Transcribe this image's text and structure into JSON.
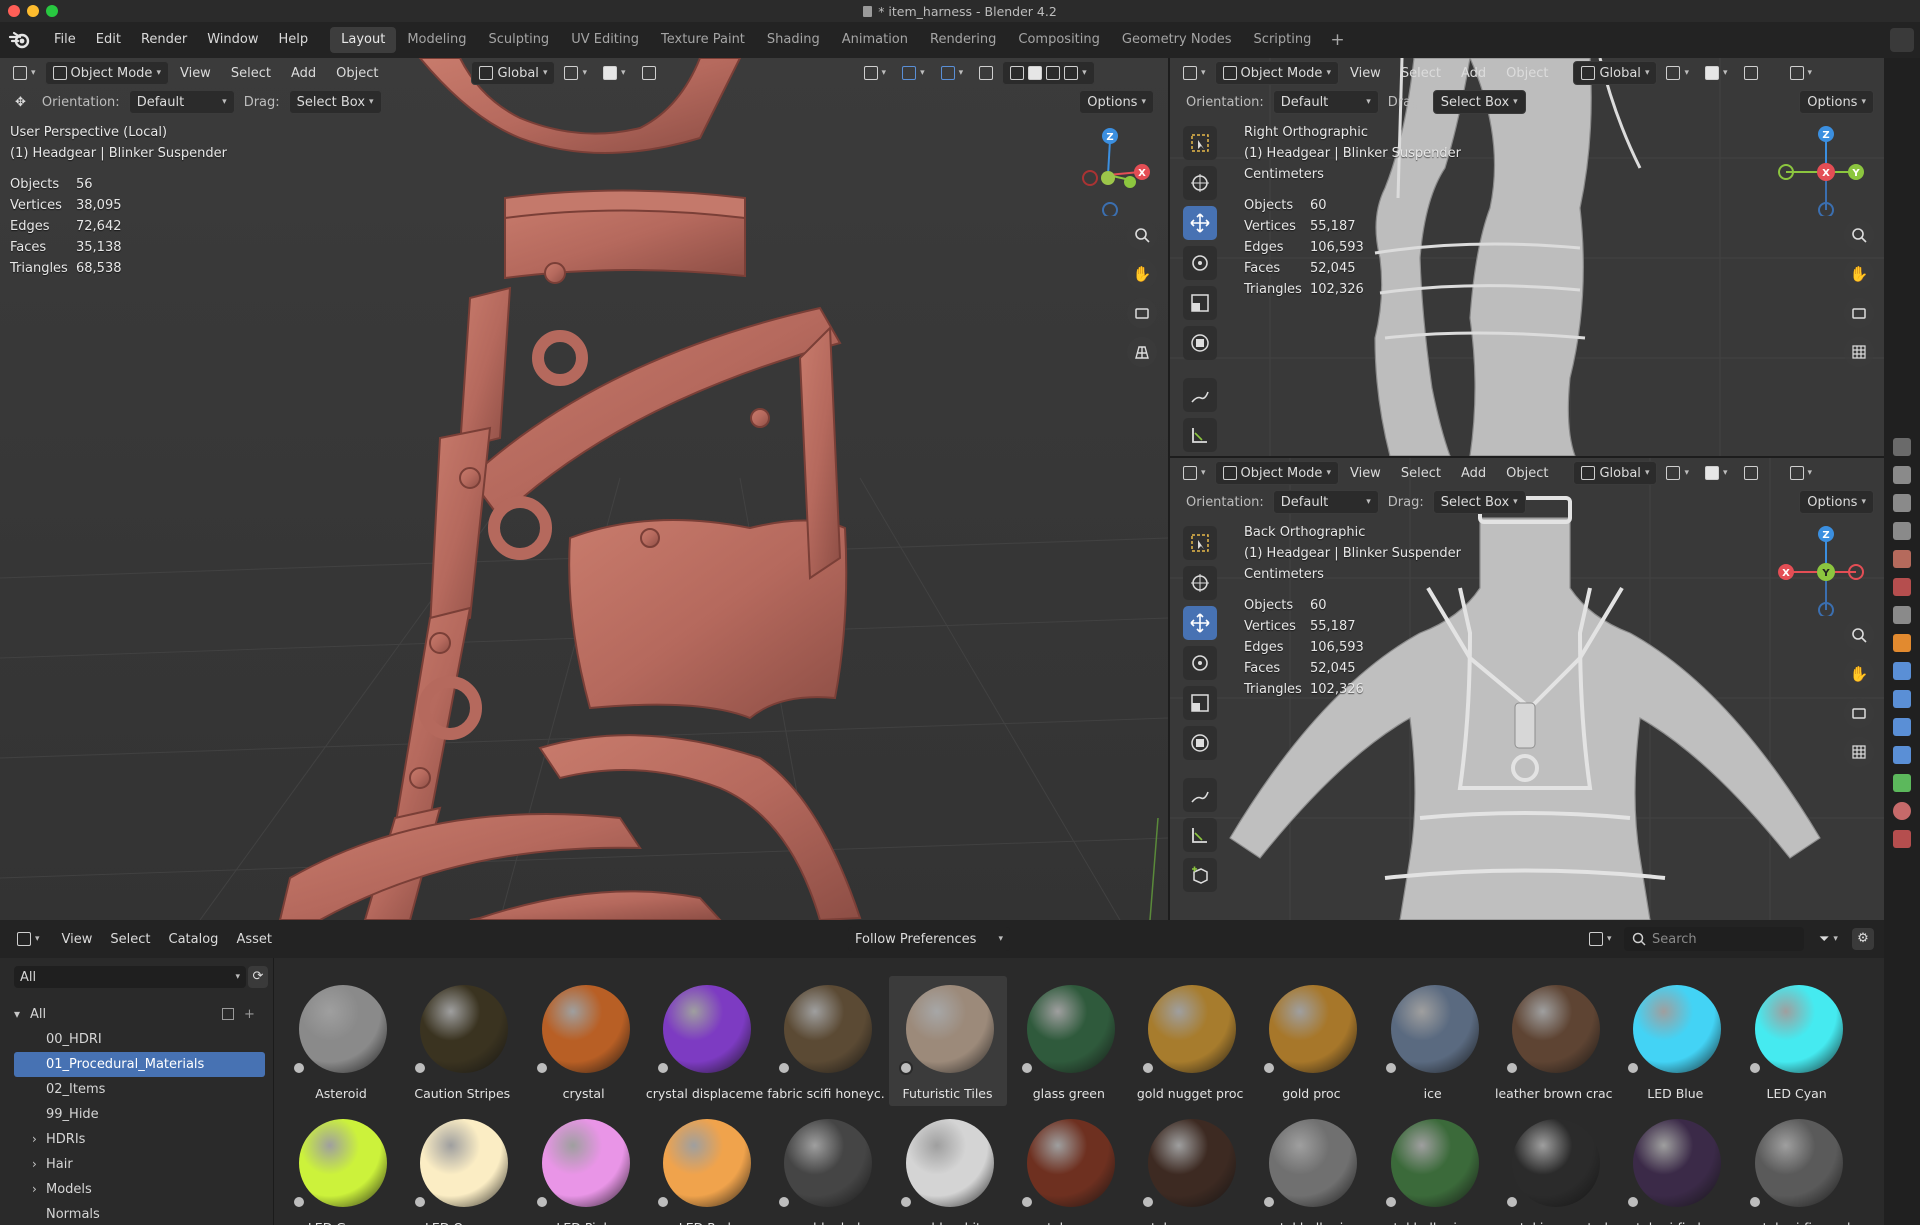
{
  "window": {
    "title": "* item_harness - Blender 4.2"
  },
  "menu": [
    "File",
    "Edit",
    "Render",
    "Window",
    "Help"
  ],
  "workspaces": [
    "Layout",
    "Modeling",
    "Sculpting",
    "UV Editing",
    "Texture Paint",
    "Shading",
    "Animation",
    "Rendering",
    "Compositing",
    "Geometry Nodes",
    "Scripting"
  ],
  "viewport_main": {
    "mode": "Object Mode",
    "menus": [
      "View",
      "Select",
      "Add",
      "Object"
    ],
    "transform_space": "Global",
    "orientation_label": "Orientation:",
    "orientation_value": "Default",
    "drag_label": "Drag:",
    "drag_value": "Select Box",
    "options": "Options",
    "view_name": "User Perspective (Local)",
    "object_name": "(1) Headgear | Blinker Suspender",
    "stats": {
      "labels": [
        "Objects",
        "Vertices",
        "Edges",
        "Faces",
        "Triangles"
      ],
      "values": [
        "56",
        "38,095",
        "72,642",
        "35,138",
        "68,538"
      ]
    },
    "gizmo": {
      "z": "Z",
      "x": "X"
    }
  },
  "viewport_right_top": {
    "mode": "Object Mode",
    "menus": [
      "View",
      "Select",
      "Add",
      "Object"
    ],
    "transform_space": "Global",
    "orientation_label": "Orientation:",
    "orientation_value": "Default",
    "drag_label": "Drag:",
    "drag_value": "Select Box",
    "options": "Options",
    "view_name": "Right Orthographic",
    "object_name": "(1) Headgear | Blinker Suspender",
    "units": "Centimeters",
    "stats": {
      "labels": [
        "Objects",
        "Vertices",
        "Edges",
        "Faces",
        "Triangles"
      ],
      "values": [
        "60",
        "55,187",
        "106,593",
        "52,045",
        "102,326"
      ]
    },
    "gizmo": {
      "z": "Z",
      "x": "X",
      "y": "Y"
    }
  },
  "viewport_right_bottom": {
    "mode": "Object Mode",
    "menus": [
      "View",
      "Select",
      "Add",
      "Object"
    ],
    "transform_space": "Global",
    "orientation_label": "Orientation:",
    "orientation_value": "Default",
    "drag_label": "Drag:",
    "drag_value": "Select Box",
    "options": "Options",
    "view_name": "Back Orthographic",
    "object_name": "(1) Headgear | Blinker Suspender",
    "units": "Centimeters",
    "stats": {
      "labels": [
        "Objects",
        "Vertices",
        "Edges",
        "Faces",
        "Triangles"
      ],
      "values": [
        "60",
        "55,187",
        "106,593",
        "52,045",
        "102,326"
      ]
    },
    "gizmo": {
      "z": "Z",
      "x": "X",
      "y": "Y"
    }
  },
  "asset_browser": {
    "menus": [
      "View",
      "Select",
      "Catalog",
      "Asset"
    ],
    "library": "Follow Preferences",
    "search_placeholder": "Search",
    "filter_value": "All",
    "tree": [
      {
        "label": "All",
        "expanded": true
      },
      {
        "label": "00_HDRI"
      },
      {
        "label": "01_Procedural_Materials",
        "selected": true
      },
      {
        "label": "02_Items"
      },
      {
        "label": "99_Hide"
      },
      {
        "label": "HDRIs",
        "collapsed": true
      },
      {
        "label": "Hair",
        "collapsed": true
      },
      {
        "label": "Models",
        "collapsed": true
      },
      {
        "label": "Normals"
      }
    ],
    "assets_row1": [
      {
        "name": "Asteroid",
        "color": "#8a8a8a"
      },
      {
        "name": "Caution Stripes",
        "color": "#3a3320"
      },
      {
        "name": "crystal",
        "color": "#b85f25"
      },
      {
        "name": "crystal displaceme...",
        "color": "#7d3bc2"
      },
      {
        "name": "fabric scifi honeyc...",
        "color": "#5b4a34"
      },
      {
        "name": "Futuristic Tiles",
        "color": "#9c8a7a",
        "selected": true
      },
      {
        "name": "glass green",
        "color": "#2f5a3c"
      },
      {
        "name": "gold nugget proc",
        "color": "#a77c2d"
      },
      {
        "name": "gold proc",
        "color": "#a7772a"
      },
      {
        "name": "ice",
        "color": "#5a6a80"
      },
      {
        "name": "leather brown crac...",
        "color": "#5e4433"
      },
      {
        "name": "LED Blue",
        "color": "#43d3f5"
      },
      {
        "name": "LED Cyan",
        "color": "#45eaf0"
      }
    ],
    "assets_row2": [
      {
        "name": "LED Green",
        "color": "#ccf23b"
      },
      {
        "name": "LED Orange",
        "color": "#fbedc4"
      },
      {
        "name": "LED Pink",
        "color": "#e995e7"
      },
      {
        "name": "LED Red",
        "color": "#f0a34c"
      },
      {
        "name": "marble dark",
        "color": "#454545"
      },
      {
        "name": "marble white",
        "color": "#d4d4d4"
      },
      {
        "name": "metal copper",
        "color": "#6e3020"
      },
      {
        "name": "metal copper corr...",
        "color": "#3d2a22"
      },
      {
        "name": "metal hull grimy",
        "color": "#707070"
      },
      {
        "name": "metal hull grimy gr...",
        "color": "#3b6a3a"
      },
      {
        "name": "metal iron rusted",
        "color": "#2b2b2b"
      },
      {
        "name": "metal sci-fi glow ...",
        "color": "#3b2a48"
      },
      {
        "name": "metal sci-fi panel",
        "color": "#5a5a5a"
      }
    ]
  },
  "colors": {
    "accent": "#4772b3",
    "harness_main": "#b5695d",
    "body_grey": "#bfbfbf",
    "gizmo_x": "#e44e55",
    "gizmo_y": "#8cc63f",
    "gizmo_z": "#3b8fe0"
  }
}
